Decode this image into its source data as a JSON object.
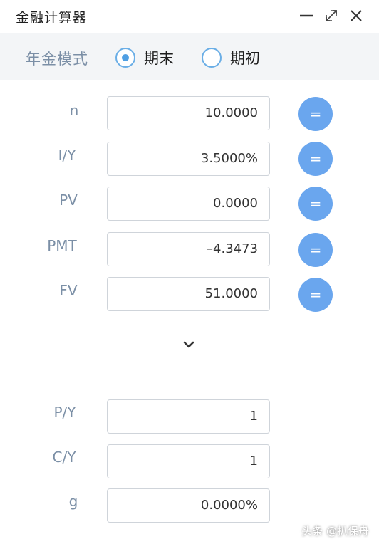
{
  "window": {
    "title": "金融计算器",
    "controls": [
      "minimize-icon",
      "maximize-icon",
      "close-icon"
    ]
  },
  "mode": {
    "label": "年金模式",
    "options": [
      {
        "label": "期末",
        "selected": true
      },
      {
        "label": "期初",
        "selected": false
      }
    ]
  },
  "tvm_rows": [
    {
      "label": "n",
      "value": "10.0000",
      "button": "="
    },
    {
      "label": "I/Y",
      "value": "3.5000%",
      "button": "="
    },
    {
      "label": "PV",
      "value": "0.0000",
      "button": "="
    },
    {
      "label": "PMT",
      "value": "–4.3473",
      "button": "="
    },
    {
      "label": "FV",
      "value": "51.0000",
      "button": "="
    }
  ],
  "expand_icon": "chevron-down-icon",
  "extra_rows": [
    {
      "label": "P/Y",
      "value": "1"
    },
    {
      "label": "C/Y",
      "value": "1"
    },
    {
      "label": "g",
      "value": "0.0000%"
    }
  ],
  "watermark": "头条 @扒保舟",
  "colors": {
    "accent": "#6aa6ee",
    "label": "#7b8fa6",
    "mode_bar_bg": "#f3f5f7"
  }
}
